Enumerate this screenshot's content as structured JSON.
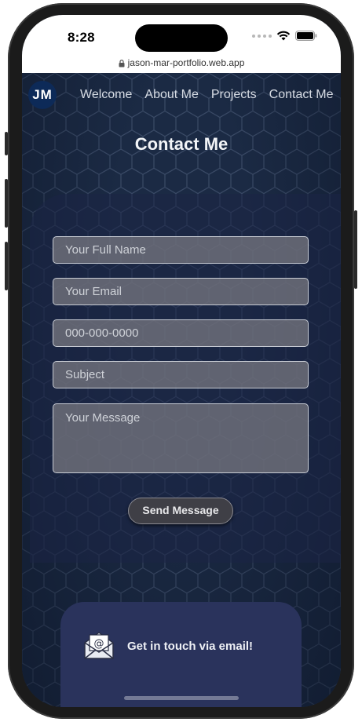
{
  "status": {
    "time": "8:28"
  },
  "browser": {
    "url": "jason-mar-portfolio.web.app"
  },
  "nav": {
    "logo": "JM",
    "links": [
      "Welcome",
      "About Me",
      "Projects",
      "Contact Me"
    ]
  },
  "page": {
    "title": "Contact Me"
  },
  "form": {
    "name_placeholder": "Your Full Name",
    "email_placeholder": "Your Email",
    "phone_placeholder": "000-000-0000",
    "subject_placeholder": "Subject",
    "message_placeholder": "Your Message",
    "send_label": "Send Message"
  },
  "email_card": {
    "text": "Get in touch via email!"
  },
  "icons": [
    "lock-icon",
    "signal-dots-icon",
    "wifi-icon",
    "battery-icon",
    "envelope-icon"
  ]
}
